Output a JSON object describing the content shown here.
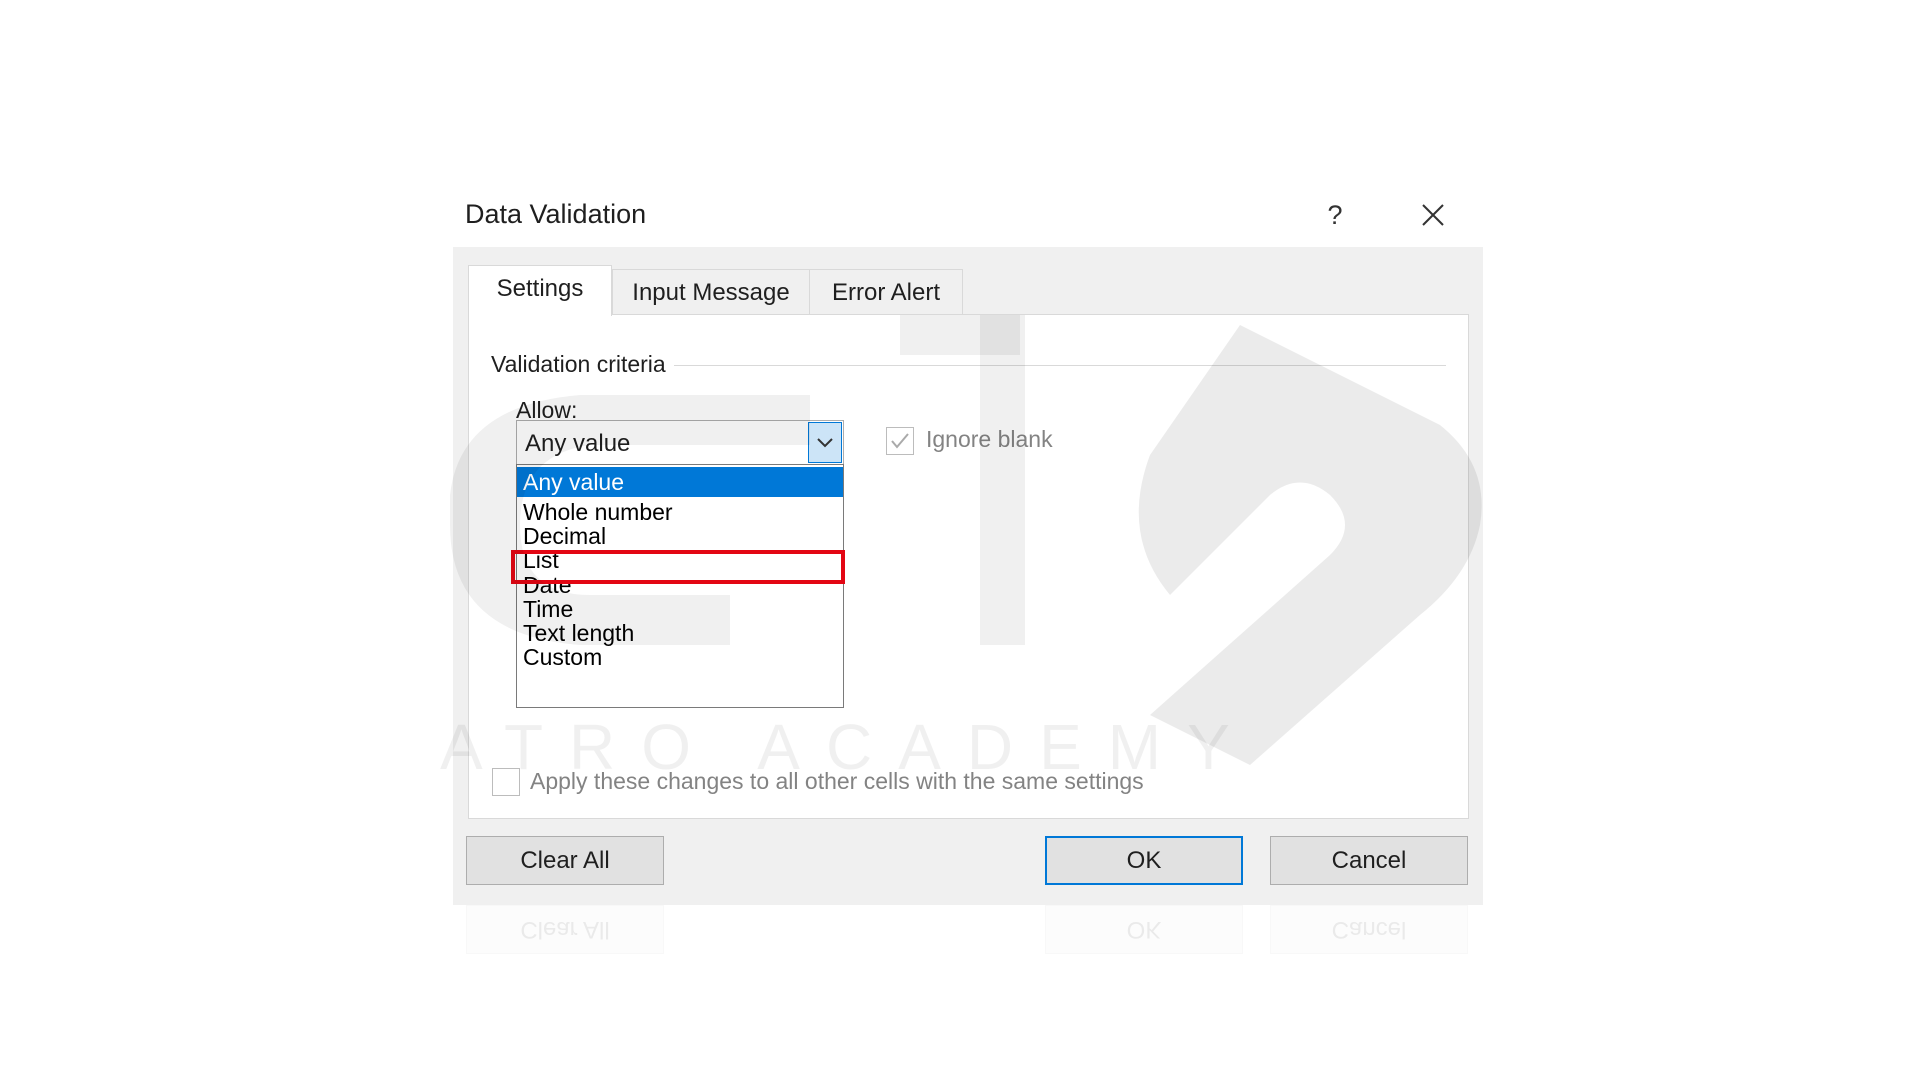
{
  "dialog": {
    "title": "Data Validation",
    "help_icon": "?",
    "close_icon": "close-icon"
  },
  "tabs": [
    {
      "label": "Settings",
      "active": true
    },
    {
      "label": "Input Message",
      "active": false
    },
    {
      "label": "Error Alert",
      "active": false
    }
  ],
  "settings": {
    "criteria_label": "Validation criteria",
    "allow_label": "Allow:",
    "allow_value": "Any value",
    "ignore_blank_label": "Ignore blank",
    "ignore_blank_checked": true,
    "ignore_blank_enabled": false,
    "options": [
      "Any value",
      "Whole number",
      "Decimal",
      "List",
      "Date",
      "Time",
      "Text length",
      "Custom"
    ],
    "selected_option": "Any value",
    "highlighted_option": "List",
    "apply_label": "Apply these changes to all other cells with the same settings",
    "apply_checked": false
  },
  "buttons": {
    "clear_all": "Clear All",
    "ok": "OK",
    "cancel": "Cancel"
  },
  "watermark": {
    "text": "ATRO ACADEMY"
  },
  "colors": {
    "selection": "#0078d7",
    "highlight_box": "#e30613",
    "dialog_bg": "#f0f0f0"
  }
}
